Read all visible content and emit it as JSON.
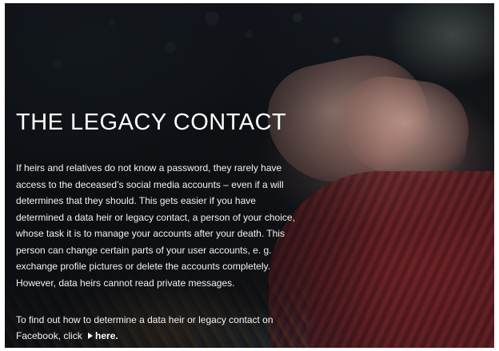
{
  "slide": {
    "title": "THE LEGACY CONTACT",
    "body": "If heirs and relatives do not know a password, they rarely have access to the deceased’s social media accounts – even if a will determines that they should. This gets easier if you have determined a data heir or legacy contact, a person of your choice, whose task it is to manage your accounts after your death. This person can change certain parts of your user accounts, e. g. exchange profile pictures or delete the accounts completely. However, data heirs cannot read private messages.",
    "cta_prefix": "To find out how to determine a data heir or legacy contact on Facebook, click",
    "cta_link_label": "here.",
    "cta_link_icon": "play-arrow-icon"
  },
  "colors": {
    "text": "#ffffff",
    "overlay": "#0a0c0f",
    "sleeve": "#7a2328"
  }
}
